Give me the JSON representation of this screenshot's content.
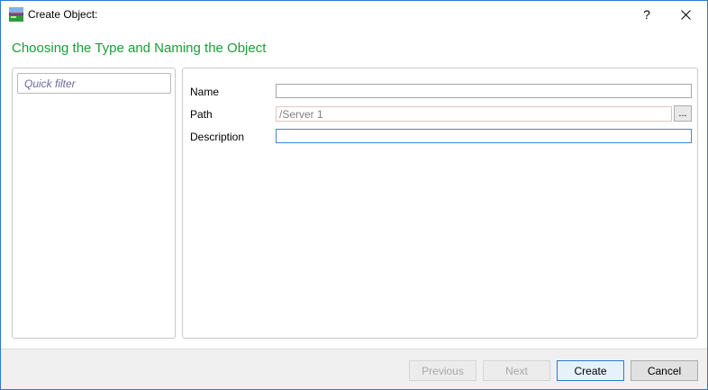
{
  "window": {
    "title": "Create Object:",
    "help_label": "?"
  },
  "heading": "Choosing the Type and Naming the Object",
  "left_panel": {
    "filter_placeholder": "Quick filter"
  },
  "form": {
    "name_label": "Name",
    "name_value": "",
    "path_label": "Path",
    "path_value": "/Server 1",
    "browse_label": "...",
    "description_label": "Description",
    "description_value": ""
  },
  "footer": {
    "previous_label": "Previous",
    "next_label": "Next",
    "create_label": "Create",
    "cancel_label": "Cancel"
  },
  "colors": {
    "accent": "#2b79d3",
    "heading": "#1a9e36"
  },
  "icons": {
    "app": "app-icon",
    "close": "close-icon"
  }
}
